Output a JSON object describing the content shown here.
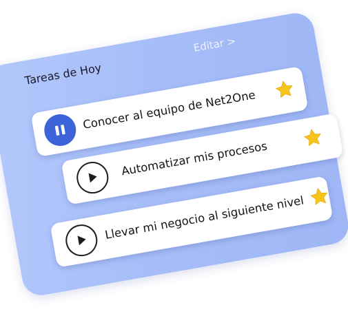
{
  "panel": {
    "title": "Tareas de Hoy",
    "edit_label": "Editar >"
  },
  "tasks": [
    {
      "label": "Conocer al equipo de Net2One",
      "state_icon": "pause-icon",
      "starred": true
    },
    {
      "label": "Automatizar mis procesos",
      "state_icon": "play-icon",
      "starred": true
    },
    {
      "label": "Llevar mi negocio al siguiente nivel",
      "state_icon": "play-icon",
      "starred": true
    }
  ],
  "colors": {
    "panel_bg": "#a6bdf8",
    "pause_button": "#3c64d8",
    "star": "#f7c41b"
  }
}
